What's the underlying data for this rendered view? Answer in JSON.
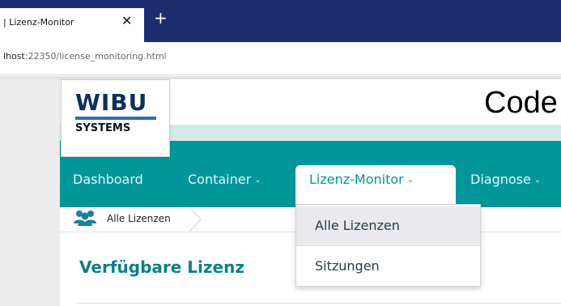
{
  "browser": {
    "tab_title": "| Lizenz-Monitor",
    "close_glyph": "✕",
    "new_tab_glyph": "+",
    "url_host": "lhost",
    "url_rest": ":22350/license_monitoring.html"
  },
  "header": {
    "logo_top": "WIBU",
    "logo_bottom": "SYSTEMS",
    "title": "Code"
  },
  "nav": {
    "items": [
      {
        "label": "Dashboard",
        "has_dropdown": false
      },
      {
        "label": "Container",
        "has_dropdown": true
      },
      {
        "label": "Lizenz-Monitor",
        "has_dropdown": true,
        "active": true
      },
      {
        "label": "Diagnose",
        "has_dropdown": true
      }
    ],
    "chevron_glyph": "⌄"
  },
  "breadcrumb": {
    "icon": "users-icon",
    "label": "Alle Lizenzen"
  },
  "content": {
    "section_title": "Verfügbare Lizenz"
  },
  "dropdown": {
    "items": [
      {
        "label": "Alle Lizenzen",
        "highlighted": true
      },
      {
        "label": "Sitzungen",
        "highlighted": false
      }
    ]
  },
  "colors": {
    "tabbar": "#1c2d6e",
    "teal": "#00969a",
    "teal_light": "#d3eaea",
    "heading_teal": "#0d7f8a",
    "crumb_icon": "#1a7f9a"
  }
}
